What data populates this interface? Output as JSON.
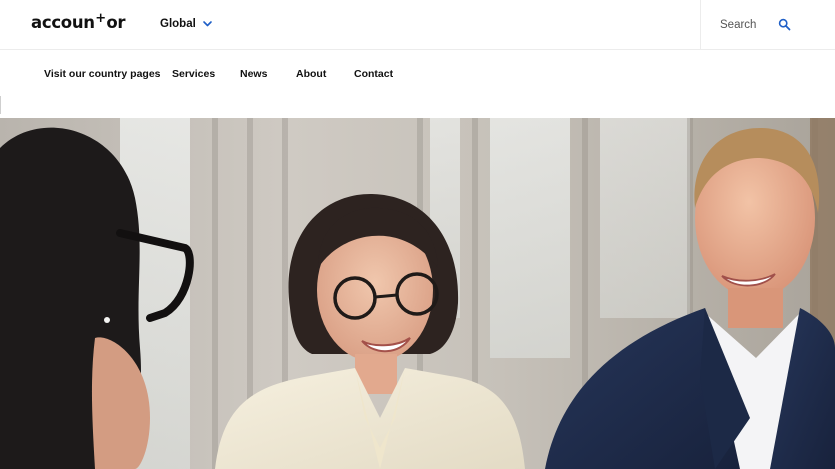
{
  "header": {
    "logo_text": "accountor",
    "logo_parts": {
      "before": "accoun",
      "mark": "+",
      "after": "or"
    },
    "region_label": "Global",
    "search_label": "Search"
  },
  "nav": {
    "items": [
      {
        "label": "Visit our country pages"
      },
      {
        "label": "Services"
      },
      {
        "label": "News"
      },
      {
        "label": "About"
      },
      {
        "label": "Contact"
      }
    ]
  },
  "icons": {
    "region_chevron": "chevron-down-icon",
    "search": "search-icon"
  },
  "colors": {
    "accent": "#1f5fc7",
    "text": "#111111",
    "border": "#ececec"
  },
  "hero": {
    "image": "photo of three people in a meeting: a woman seen from behind with glasses on the left, a smiling woman with glasses in a cream blazer in the center, a smiling man in a navy suit on the right"
  }
}
